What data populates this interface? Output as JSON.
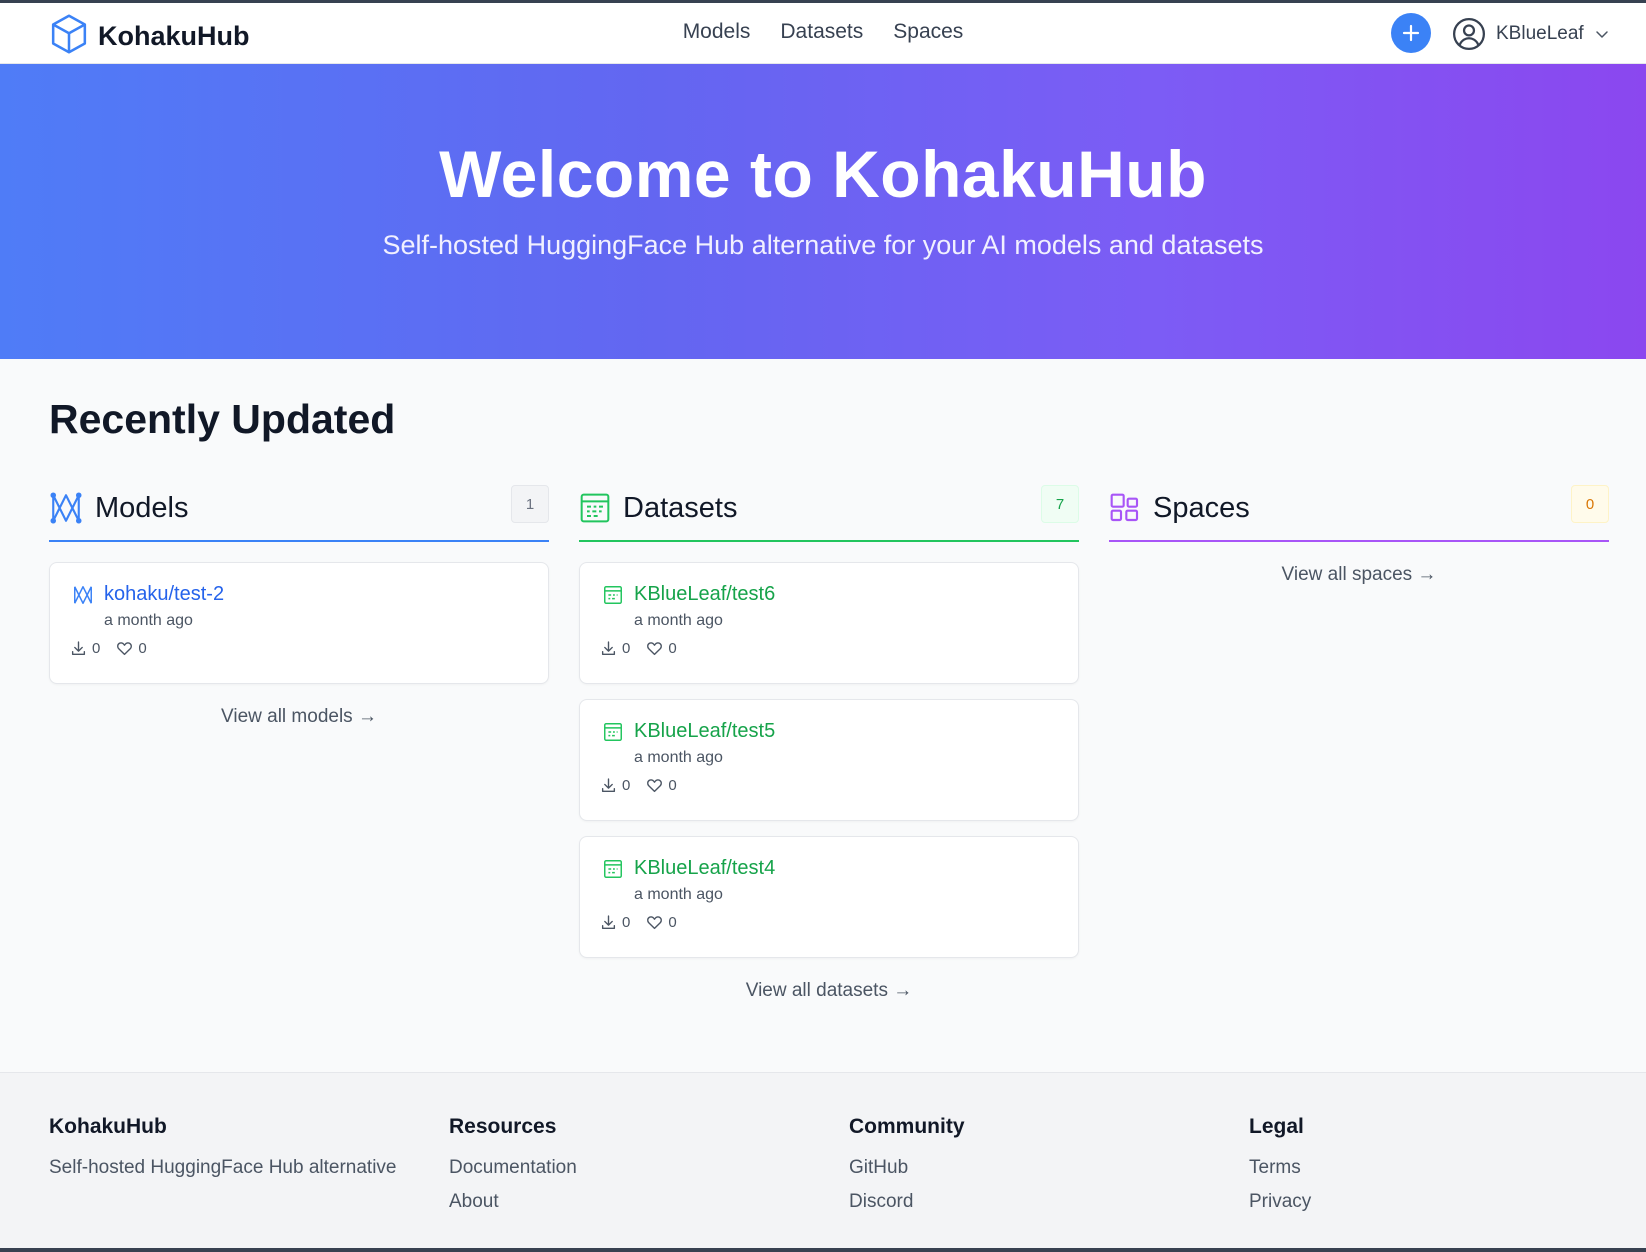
{
  "header": {
    "brand": "KohakuHub",
    "nav": [
      "Models",
      "Datasets",
      "Spaces"
    ],
    "username": "KBlueLeaf",
    "colors": {
      "accent": "#3b82f6"
    }
  },
  "hero": {
    "title": "Welcome to KohakuHub",
    "subtitle": "Self-hosted HuggingFace Hub alternative for your AI models and datasets"
  },
  "recent": {
    "title": "Recently Updated",
    "models": {
      "label": "Models",
      "count": "1",
      "color": "#2563eb",
      "items": [
        {
          "name": "kohaku/test-2",
          "time": "a month ago",
          "downloads": "0",
          "likes": "0"
        }
      ],
      "view_all": "View all models →"
    },
    "datasets": {
      "label": "Datasets",
      "count": "7",
      "color": "#16a34a",
      "items": [
        {
          "name": "KBlueLeaf/test6",
          "time": "a month ago",
          "downloads": "0",
          "likes": "0"
        },
        {
          "name": "KBlueLeaf/test5",
          "time": "a month ago",
          "downloads": "0",
          "likes": "0"
        },
        {
          "name": "KBlueLeaf/test4",
          "time": "a month ago",
          "downloads": "0",
          "likes": "0"
        }
      ],
      "view_all": "View all datasets →"
    },
    "spaces": {
      "label": "Spaces",
      "count": "0",
      "color": "#9333ea",
      "items": [],
      "view_all": "View all spaces →"
    }
  },
  "footer": {
    "brand": {
      "title": "KohakuHub",
      "tagline": "Self-hosted HuggingFace Hub alternative"
    },
    "resources": {
      "title": "Resources",
      "links": [
        "Documentation",
        "About"
      ]
    },
    "community": {
      "title": "Community",
      "links": [
        "GitHub",
        "Discord"
      ]
    },
    "legal": {
      "title": "Legal",
      "links": [
        "Terms",
        "Privacy"
      ]
    }
  }
}
